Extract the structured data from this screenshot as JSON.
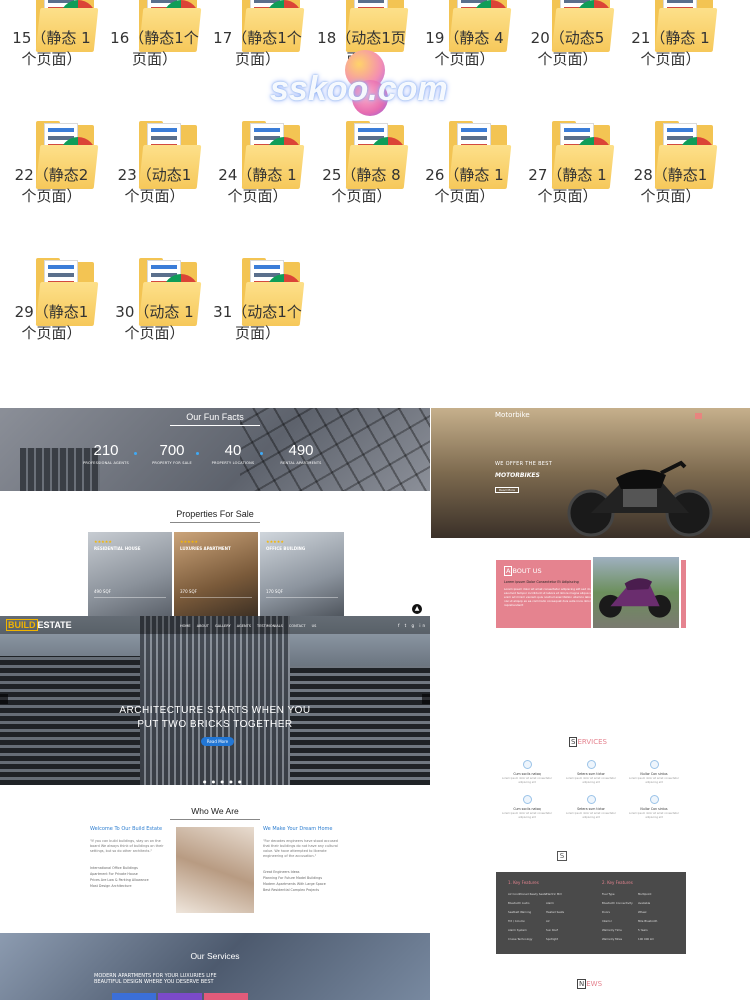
{
  "folders": [
    {
      "l1": "15（静态 1",
      "l2": "个页面）"
    },
    {
      "l1": "16（静态1个",
      "l2": "页面）"
    },
    {
      "l1": "17（静态1个",
      "l2": "页面）"
    },
    {
      "l1": "18（动态1页",
      "l2": "面）"
    },
    {
      "l1": "19（静态 4",
      "l2": "个页面）"
    },
    {
      "l1": "20（动态5",
      "l2": "个页面）"
    },
    {
      "l1": "21（静态 1",
      "l2": "个页面）"
    },
    {
      "l1": "22（静态2",
      "l2": "个页面）"
    },
    {
      "l1": "23（动态1",
      "l2": "个页面）"
    },
    {
      "l1": "24（静态 1",
      "l2": "个页面）"
    },
    {
      "l1": "25（静态 8",
      "l2": "个页面）"
    },
    {
      "l1": "26（静态 1",
      "l2": "个页面）"
    },
    {
      "l1": "27（静态 1",
      "l2": "个页面）"
    },
    {
      "l1": "28（静态1",
      "l2": "个页面）"
    },
    {
      "l1": "29（静态1",
      "l2": "个页面）"
    },
    {
      "l1": "30（动态 1",
      "l2": "个页面）"
    },
    {
      "l1": "31（动态1个",
      "l2": "页面）"
    }
  ],
  "watermark": "sskoo.com",
  "funfacts": {
    "title": "Our Fun Facts",
    "stats": [
      {
        "n": "210",
        "l": "PROFESSIONAL AGENTS"
      },
      {
        "n": "700",
        "l": "PROPERTY FOR SALE"
      },
      {
        "n": "40",
        "l": "PROPERTY LOCATIONS"
      },
      {
        "n": "490",
        "l": "RENTAL APARTMENTS"
      }
    ]
  },
  "properties": {
    "title": "Properties For Sale",
    "cards": [
      {
        "title": "RESIDENTIAL HOUSE",
        "price": "490 SQF"
      },
      {
        "title": "LUXURIES APARTMENT",
        "price": "370 SQF"
      },
      {
        "title": "OFFICE BUILDING",
        "price": "170 SQF"
      }
    ]
  },
  "hero": {
    "logo_a": "BUILD",
    "logo_b": "ESTATE",
    "nav": "HOME ABOUT GALLERY AGENTS TESTIMONIALS CONTACT US",
    "social": "f t g in",
    "headline1": "ARCHITECTURE STARTS WHEN YOU",
    "headline2": "PUT TWO BRICKS TOGETHER",
    "button": "Read More",
    "dots": "● ● ● ● ●"
  },
  "who": {
    "title": "Who We Are",
    "left_h": "Welcome To Our Build Estate",
    "left_p": "\"If you can build buildings, stay on on the board We always think of buildings on their settings, but so do other architects.\"",
    "left_list": [
      "International Office Buildings",
      "Apartment For Private House",
      "Prices Are Low & Parking Allowance",
      "Most Design Architecture"
    ],
    "right_h": "We Make Your Dream Home",
    "right_p": "\"For decades engineers have stood accused that their buildings do not have any cultural value. We have attempted to liberate engineering of the accusation.\"",
    "right_list": [
      "Great Engineers Ideas",
      "Planning For Future Model Buildings",
      "Modern Apartments With Large Space",
      "Best Residential Complex Projects"
    ]
  },
  "services_dark": {
    "title": "Our Services",
    "line1": "MODERN APARTMENTS FOR YOUR LUXURIES LIFE",
    "line2": "BEAUTIFUL DESIGN WHERE YOU DESERVE BEST",
    "bars": [
      "#3b6fd8",
      "#7b4ac9",
      "#e25b7a"
    ]
  },
  "moto": {
    "title": "Motorbike",
    "h1": "WE OFFER THE BEST",
    "h2": "MOTORBIKES",
    "button": "Read More"
  },
  "about": {
    "letter": "A",
    "title": "BOUT US",
    "sub": "Lorem ipsum Dolor Consectetur Et Adipiscing",
    "para": "Lorem ipsum dolor sit amet consectetur adipiscing elit sed do eiusmod tempor incididunt ut labore et dolore magna aliqua ut enim ad minim veniam quis nostrud exercitation ullamco laboris nisi ut aliquip ex ea commodo consequat duis aute irure dolor in reprehenderit"
  },
  "services_pink": {
    "letter": "S",
    "title": "ERVICES",
    "items": [
      {
        "n": "Cum sociis natoq",
        "d": "Lorem ipsum dolor sit amet consectetur adipiscing elit"
      },
      {
        "n": "Setera sum tictor",
        "d": "Lorem ipsum dolor sit amet consectetur adipiscing elit"
      },
      {
        "n": "Nullor Con sintus",
        "d": "Lorem ipsum dolor sit amet consectetur adipiscing elit"
      },
      {
        "n": "Cum sociis natoq",
        "d": "Lorem ipsum dolor sit amet consectetur adipiscing elit"
      },
      {
        "n": "Setera sum tictor",
        "d": "Lorem ipsum dolor sit amet consectetur adipiscing elit"
      },
      {
        "n": "Nullor Con sintus",
        "d": "Lorem ipsum dolor sit amet consectetur adipiscing elit"
      }
    ],
    "box_letter": "S",
    "features": {
      "h1": "1. Key Features",
      "h2": "2. Key Features",
      "left": [
        [
          "Air Conditioned Ready Seats",
          "Electric Mirr"
        ],
        [
          "Bluetooth Audio",
          "Alarm"
        ],
        [
          "Seatbelt Warning",
          "Heated Seats"
        ],
        [
          "Tilt / Column",
          "Air"
        ],
        [
          "Alarm System",
          "Sun Roof"
        ],
        [
          "Cruise Technology",
          "Spotlight"
        ]
      ],
      "right": [
        [
          "Fuel Type",
          "Multipoint"
        ],
        [
          "Bluetooth Connectivity",
          "Available"
        ],
        [
          "Doors",
          "Wheel"
        ],
        [
          "Interior",
          "Mile Bluetooth"
        ],
        [
          "Warranty Time",
          "5 Years"
        ],
        [
          "Warranty Miles",
          "100 000 km"
        ]
      ]
    },
    "news_letter": "N",
    "news": "EWS"
  }
}
